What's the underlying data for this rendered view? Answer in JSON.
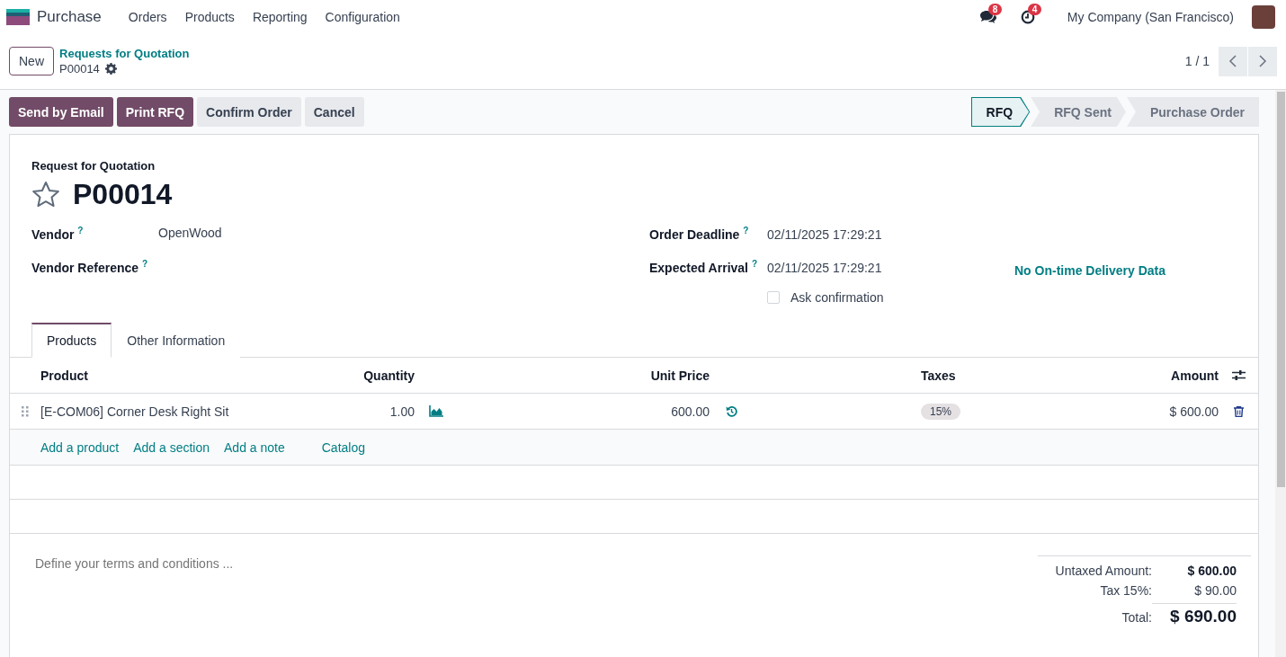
{
  "navbar": {
    "app_name": "Purchase",
    "menu": [
      "Orders",
      "Products",
      "Reporting",
      "Configuration"
    ],
    "messages_count": "8",
    "activities_count": "4",
    "company": "My Company (San Francisco)"
  },
  "control_panel": {
    "new_button": "New",
    "breadcrumb": "Requests for Quotation",
    "record": "P00014",
    "pager": "1 / 1"
  },
  "actions": [
    {
      "label": "Send by Email",
      "kind": "primary"
    },
    {
      "label": "Print RFQ",
      "kind": "primary"
    },
    {
      "label": "Confirm Order",
      "kind": "secondary"
    },
    {
      "label": "Cancel",
      "kind": "secondary"
    }
  ],
  "statusbar": [
    {
      "label": "RFQ",
      "selected": true
    },
    {
      "label": "RFQ Sent",
      "selected": false
    },
    {
      "label": "Purchase Order",
      "selected": false
    }
  ],
  "form": {
    "subtitle": "Request for Quotation",
    "name": "P00014",
    "starred": false,
    "left_fields": [
      {
        "label": "Vendor",
        "help": "?",
        "value": "OpenWood"
      },
      {
        "label": "Vendor Reference",
        "help": "?"
      }
    ],
    "right_fields": [
      {
        "label": "Order Deadline",
        "help": "?",
        "value": "02/11/2025 17:29:21"
      },
      {
        "label": "Expected Arrival",
        "help": "?",
        "value": "02/11/2025 17:29:21"
      }
    ],
    "delivery_note": "No On-time Delivery Data",
    "ask_confirmation": {
      "label": "Ask confirmation",
      "checked": false
    }
  },
  "tabs": [
    {
      "label": "Products",
      "selected": true
    },
    {
      "label": "Other Information",
      "selected": false
    }
  ],
  "table": {
    "columns": [
      "Product",
      "Quantity",
      "Unit Price",
      "Taxes",
      "Amount"
    ],
    "rows": [
      {
        "product": "[E-COM06] Corner Desk Right Sit",
        "quantity": "1.00",
        "unit_price": "600.00",
        "taxes": "15%",
        "amount": "$ 600.00"
      }
    ],
    "add_links": [
      "Add a product",
      "Add a section",
      "Add a note",
      "Catalog"
    ]
  },
  "terms_placeholder": "Define your terms and conditions ...",
  "totals": [
    {
      "label": "Untaxed Amount:",
      "value": "$ 600.00",
      "kind": "subtotal"
    },
    {
      "label": "Tax 15%:",
      "value": "$ 90.00",
      "kind": "tax"
    },
    {
      "label": "Total:",
      "value": "$ 690.00",
      "kind": "total"
    }
  ]
}
